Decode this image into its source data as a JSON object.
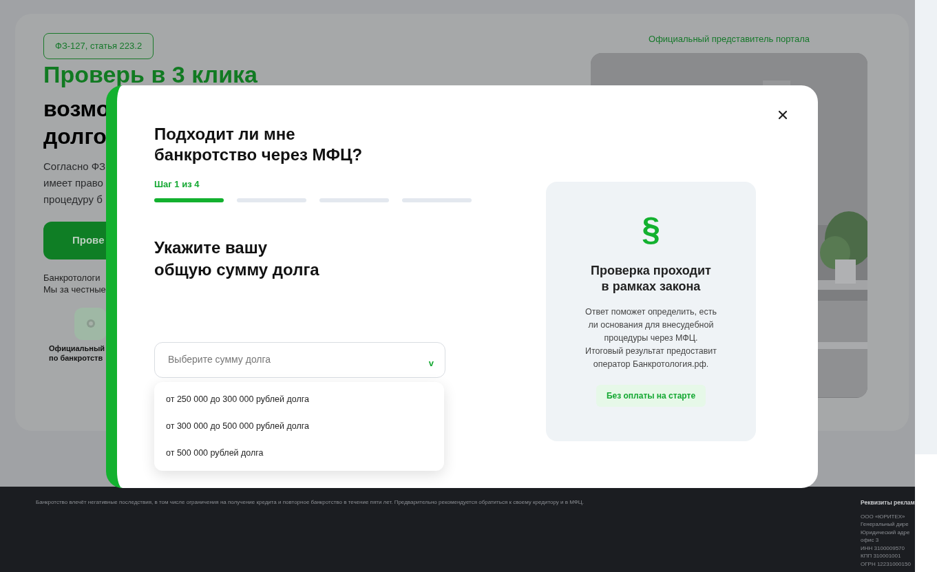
{
  "hero": {
    "law_badge": "ФЗ-127, статья 223.2",
    "title_accent": "Проверь в 3 клика",
    "title_lines": [
      "возмо",
      "долго"
    ],
    "description_lines": [
      "Согласно ФЗ",
      "имеет право",
      "процедуру б"
    ],
    "cta_button": "Прове",
    "note_lines": [
      "Банкротологи",
      "Мы за честные"
    ],
    "feature_caption_lines": [
      "Официальный",
      "по банкротств"
    ],
    "representative_label": "Официальный представитель портала"
  },
  "modal": {
    "title_lines": [
      "Подходит ли мне",
      "банкротство через МФЦ?"
    ],
    "step_label": "Шаг 1 из 4",
    "steps": [
      {
        "active": true
      },
      {
        "active": false
      },
      {
        "active": false
      },
      {
        "active": false
      }
    ],
    "question_lines": [
      "Укажите вашу",
      "общую сумму долга"
    ],
    "select": {
      "placeholder": "Выберите сумму долга",
      "chevron": "v",
      "expanded": true,
      "options": [
        "от 250 000 до 300 000 рублей долга",
        "от 300 000 до 500 000 рублей долга",
        "от 500 000 рублей долга"
      ]
    },
    "info_card": {
      "symbol": "§",
      "title_lines": [
        "Проверка проходит",
        "в рамках закона"
      ],
      "text_lines": [
        "Ответ поможет определить, есть",
        "ли основания для внесудебной",
        "процедуры через МФЦ.",
        "Итоговый результат предоставит",
        "оператор Банкротология.рф."
      ],
      "badge": "Без оплаты на старте"
    }
  },
  "footer": {
    "disclaimer": "Банкротство влечёт негативные последствия, в том числе ограничения на получение кредита и повторное банкротство в течение пяти лет. Предварительно рекомендуется обратиться к своему кредитору и в МФЦ.",
    "requisites_title": "Реквизиты реклам",
    "requisites_lines": [
      "ООО «ЮРИТЕХ»",
      "Генеральный дире",
      "Юридический адре",
      "офис 3",
      "ИНН 3100009570",
      "КПП 310001001",
      "ОГРН 12231000150"
    ]
  }
}
